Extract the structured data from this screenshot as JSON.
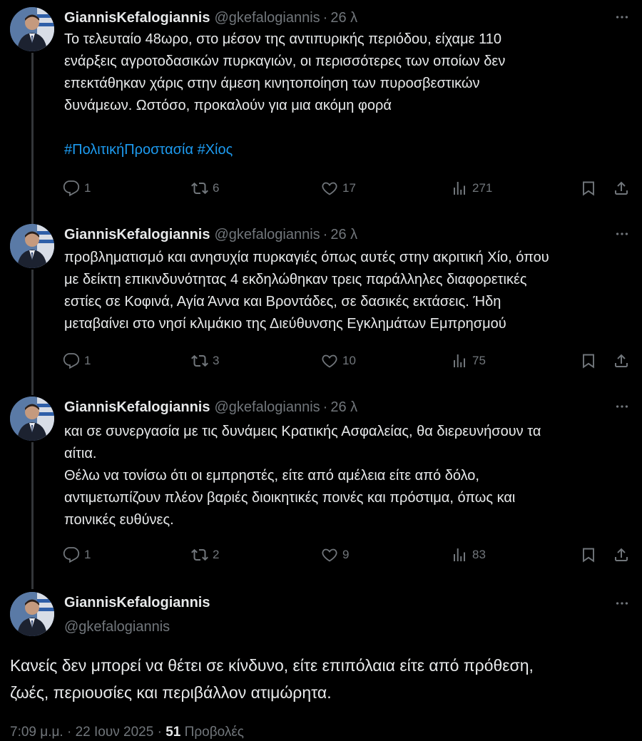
{
  "author": {
    "name": "GiannisKefalogiannis",
    "handle": "@gkefalogiannis"
  },
  "thread": [
    {
      "time": "26 λ",
      "lines": [
        "Το τελευταίο 48ωρο, στο μέσον της αντιπυρικής περιόδου, είχαμε 110",
        "ενάρξεις αγροτοδασικών πυρκαγιών, οι περισσότερες των οποίων δεν",
        "επεκτάθηκαν χάρις στην άμεση κινητοποίηση των πυροσβεστικών",
        "δυνάμεων. Ωστόσο, προκαλούν για μια ακόμη φορά"
      ],
      "hashtags": "#ΠολιτικήΠροστασία #Χίος",
      "replies": "1",
      "reposts": "6",
      "likes": "17",
      "views": "271"
    },
    {
      "time": "26 λ",
      "lines": [
        "προβληματισμό και ανησυχία πυρκαγιές όπως αυτές στην ακριτική Χίο, όπου",
        "με δείκτη επικινδυνότητας 4 εκδηλώθηκαν τρεις παράλληλες διαφορετικές",
        "εστίες σε Κοφινά, Αγία Άννα και Βροντάδες, σε δασικές εκτάσεις. Ήδη",
        "μεταβαίνει στο νησί κλιμάκιο της Διεύθυνσης Εγκλημάτων Εμπρησμού"
      ],
      "replies": "1",
      "reposts": "3",
      "likes": "10",
      "views": "75"
    },
    {
      "time": "26 λ",
      "lines": [
        "και σε συνεργασία με τις δυνάμεις Κρατικής Ασφαλείας, θα διερευνήσουν τα",
        "αίτια.",
        "Θέλω να τονίσω ότι οι εμπρηστές, είτε από αμέλεια είτε από δόλο,",
        "αντιμετωπίζουν πλέον βαριές διοικητικές ποινές και πρόστιμα, όπως και",
        "ποινικές ευθύνες."
      ],
      "replies": "1",
      "reposts": "2",
      "likes": "9",
      "views": "83"
    }
  ],
  "main_tweet": {
    "lines": [
      "Κανείς δεν μπορεί να θέτει σε κίνδυνο, είτε επιπόλαια είτε από πρόθεση,",
      "ζωές, περιουσίες και περιβάλλον ατιμώρητα."
    ],
    "timestamp": "7:09 μ.μ. · 22 Ιουν 2025 ·",
    "views_count": "51",
    "views_label": "Προβολές"
  },
  "colors": {
    "background": "#000000",
    "text": "#e7e9ea",
    "muted": "#71767b",
    "link": "#1d9bf0",
    "thread_line": "#333639"
  },
  "icons": [
    "reply-icon",
    "repost-icon",
    "like-icon",
    "views-icon",
    "bookmark-icon",
    "share-icon",
    "more-icon"
  ]
}
